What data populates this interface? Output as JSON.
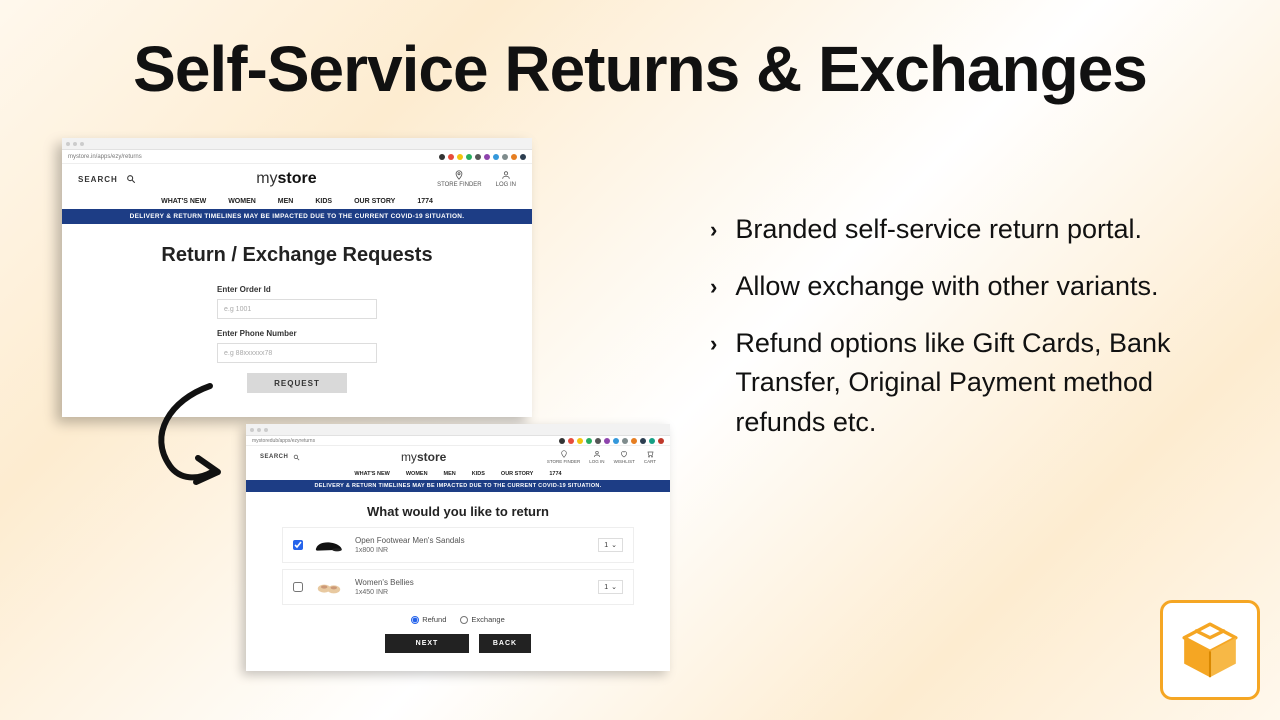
{
  "title": "Self-Service Returns & Exchanges",
  "bullets": [
    "Branded self-service return portal.",
    "Allow exchange with other variants.",
    "Refund options like Gift Cards, Bank Transfer, Original Payment method refunds etc."
  ],
  "shot1": {
    "url": "mystore.in/apps/ezy/returns",
    "search_label": "SEARCH",
    "logo_pre": "my",
    "logo_bold": "store",
    "icon_storefinder": "STORE FINDER",
    "icon_login": "LOG IN",
    "nav": [
      "WHAT'S NEW",
      "WOMEN",
      "MEN",
      "KIDS",
      "OUR STORY",
      "1774"
    ],
    "banner": "DELIVERY & RETURN TIMELINES MAY BE IMPACTED DUE TO THE CURRENT COVID-19 SITUATION.",
    "heading": "Return / Exchange Requests",
    "order_label": "Enter Order Id",
    "order_ph": "e.g 1001",
    "phone_label": "Enter Phone Number",
    "phone_ph": "e.g 88xxxxxx78",
    "request_btn": "REQUEST"
  },
  "shot2": {
    "url": "mystoredub/apps/ezyreturns",
    "search_label": "SEARCH",
    "logo_pre": "my",
    "logo_bold": "store",
    "icons": [
      "STORE FINDER",
      "LOG IN",
      "WISHLIST",
      "CART"
    ],
    "nav": [
      "WHAT'S NEW",
      "WOMEN",
      "MEN",
      "KIDS",
      "OUR STORY",
      "1774"
    ],
    "banner": "DELIVERY & RETURN TIMELINES MAY BE IMPACTED DUE TO THE CURRENT COVID-19 SITUATION.",
    "heading": "What would you like to return",
    "items": [
      {
        "checked": true,
        "name": "Open Footwear Men's Sandals",
        "price": "1x800 INR",
        "qty": "1"
      },
      {
        "checked": false,
        "name": "Women's Bellies",
        "price": "1x450 INR",
        "qty": "1"
      }
    ],
    "refund_label": "Refund",
    "exchange_label": "Exchange",
    "next_btn": "NEXT",
    "back_btn": "BACK"
  }
}
